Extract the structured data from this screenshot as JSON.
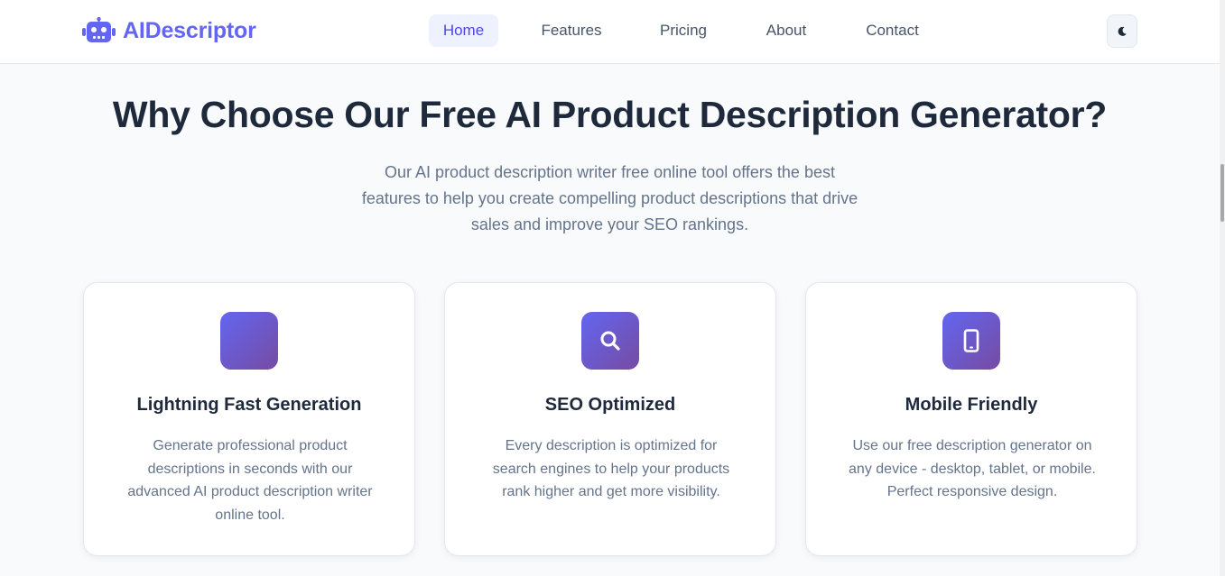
{
  "brand": {
    "name": "AIDescriptor",
    "logo_icon": "robot-icon",
    "accent_color": "#6366f1"
  },
  "nav": {
    "items": [
      {
        "label": "Home",
        "active": true
      },
      {
        "label": "Features",
        "active": false
      },
      {
        "label": "Pricing",
        "active": false
      },
      {
        "label": "About",
        "active": false
      },
      {
        "label": "Contact",
        "active": false
      }
    ],
    "theme_toggle_icon": "moon-icon"
  },
  "section": {
    "title": "Why Choose Our Free AI Product Description Generator?",
    "subtitle_lines": [
      "Our AI product description writer free online tool offers the best",
      "features to help you create compelling product descriptions that drive",
      "sales and improve your SEO rankings."
    ]
  },
  "features": [
    {
      "icon": "lightning-icon",
      "title": "Lightning Fast Generation",
      "description_lines": [
        "Generate professional product",
        "descriptions in seconds with our",
        "advanced AI product description writer",
        "online tool."
      ]
    },
    {
      "icon": "search-icon",
      "title": "SEO Optimized",
      "description_lines": [
        "Every description is optimized for",
        "search engines to help your products",
        "rank higher and get more visibility."
      ]
    },
    {
      "icon": "mobile-icon",
      "title": "Mobile Friendly",
      "description_lines": [
        "Use our free description generator on",
        "any device - desktop, tablet, or mobile.",
        "Perfect responsive design."
      ]
    }
  ],
  "colors": {
    "icon_gradient_start": "#6366f1",
    "icon_gradient_end": "#764ba2",
    "heading": "#1e293b",
    "body_text": "#64748b"
  }
}
